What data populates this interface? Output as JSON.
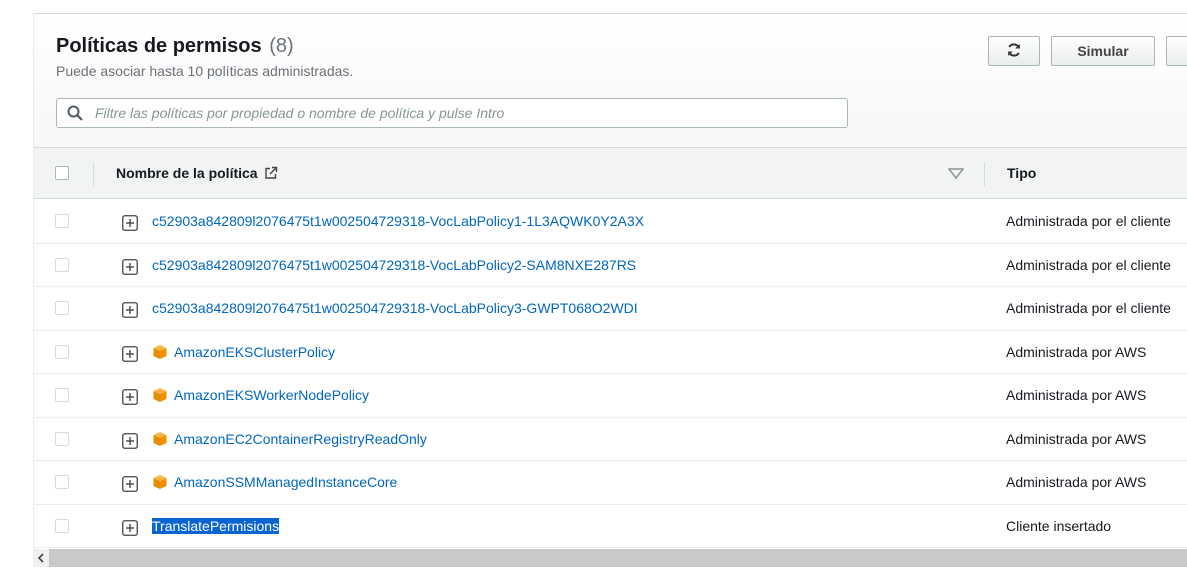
{
  "header": {
    "title": "Políticas de permisos",
    "count": "(8)",
    "subtitle": "Puede asociar hasta 10 políticas administradas.",
    "simulate_label": "Simular"
  },
  "search": {
    "placeholder": "Filtre las políticas por propiedad o nombre de política y pulse Intro"
  },
  "table": {
    "columns": {
      "name": "Nombre de la política",
      "type": "Tipo"
    },
    "rows": [
      {
        "name": "c52903a842809l2076475t1w002504729318-VocLabPolicy1-1L3AQWK0Y2A3X",
        "type": "Administrada por el cliente",
        "aws_icon": false
      },
      {
        "name": "c52903a842809l2076475t1w002504729318-VocLabPolicy2-SAM8NXE287RS",
        "type": "Administrada por el cliente",
        "aws_icon": false
      },
      {
        "name": "c52903a842809l2076475t1w002504729318-VocLabPolicy3-GWPT068O2WDI",
        "type": "Administrada por el cliente",
        "aws_icon": false
      },
      {
        "name": "AmazonEKSClusterPolicy",
        "type": "Administrada por AWS",
        "aws_icon": true
      },
      {
        "name": "AmazonEKSWorkerNodePolicy",
        "type": "Administrada por AWS",
        "aws_icon": true
      },
      {
        "name": "AmazonEC2ContainerRegistryReadOnly",
        "type": "Administrada por AWS",
        "aws_icon": true
      },
      {
        "name": "AmazonSSMManagedInstanceCore",
        "type": "Administrada por AWS",
        "aws_icon": true
      },
      {
        "name": "TranslatePermisions",
        "type": "Cliente insertado",
        "aws_icon": false,
        "selected": true
      }
    ]
  },
  "icons": {
    "refresh": "refresh-icon",
    "search": "search-icon",
    "external_link": "external-link-icon",
    "sort": "sort-down-icon",
    "expand": "expand-plus-icon",
    "aws_managed": "aws-cube-icon",
    "scroll_left": "scroll-left-arrow-icon"
  },
  "colors": {
    "link": "#0066c0",
    "selection": "#0a64d2",
    "aws_orange": "#f29100"
  }
}
